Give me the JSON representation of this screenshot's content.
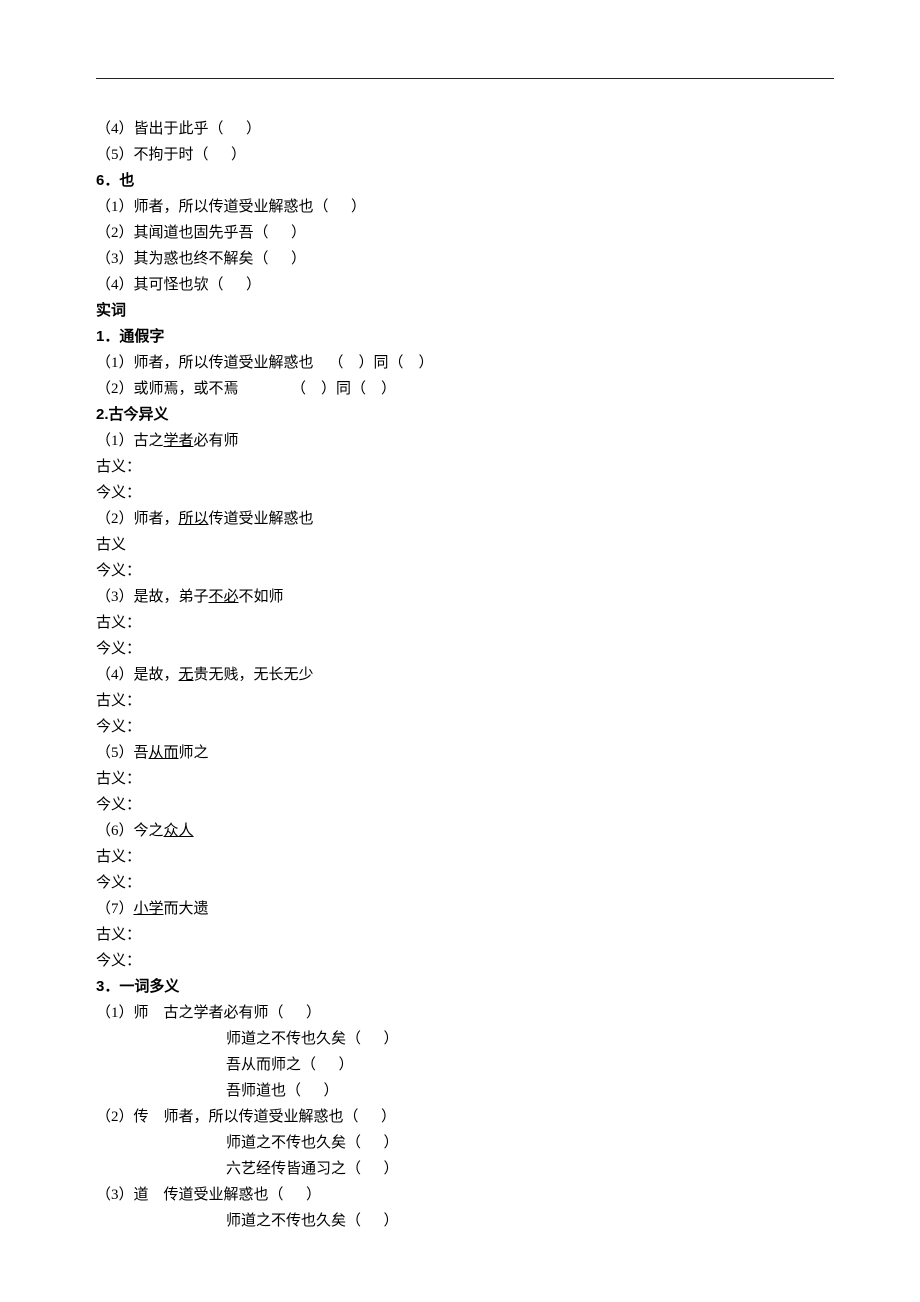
{
  "topLines": [
    "（4）皆出于此乎（      ）",
    "（5）不拘于时（      ）"
  ],
  "sec6": {
    "title": "6．也",
    "items": [
      "（1）师者，所以传道受业解惑也（      ）",
      "（2）其闻道也固先乎吾（      ）",
      "（3）其为惑也终不解矣（      ）",
      "（4）其可怪也欤（      ）"
    ]
  },
  "shici": "实词",
  "tongjia": {
    "title": "1．通假字",
    "items": [
      "（1）师者，所以传道受业解惑也    （    ）同（    ）",
      "（2）或师焉，或不焉              （    ）同（    ）"
    ]
  },
  "gujin": {
    "title": "2.古今异义",
    "items": [
      {
        "num": "（1）古之",
        "u": "学者",
        "rest": "必有师",
        "gu": "古义：",
        "jin": "今义："
      },
      {
        "num": "（2）师者，",
        "u": "所以",
        "rest": "传道受业解惑也",
        "gu": "古义",
        "jin": "今义："
      },
      {
        "num": "（3）是故，弟子",
        "u": "不必",
        "rest": "不如师",
        "gu": "古义：",
        "jin": "今义："
      },
      {
        "num": "（4）是故，",
        "u": "无",
        "rest": "贵无贱，无长无少",
        "gu": "古义：",
        "jin": "今义："
      },
      {
        "num": "（5）吾",
        "u": "从而",
        "rest": "师之",
        "gu": "古义：",
        "jin": "今义："
      },
      {
        "num": "（6）今之",
        "u": "众人",
        "rest": "",
        "gu": "古义：",
        "jin": "今义："
      },
      {
        "num": "（7）",
        "u": "小学",
        "rest": "而大遗",
        "gu": "古义：",
        "jin": "今义："
      }
    ]
  },
  "duoyi": {
    "title": "3．一词多义",
    "items": [
      {
        "head": "（1）师",
        "ex": [
          "古之学者必有师（      ）",
          "师道之不传也久矣（      ）",
          "吾从而师之（      ）",
          "吾师道也（      ）"
        ]
      },
      {
        "head": "（2）传",
        "ex": [
          "师者，所以传道受业解惑也（      ）",
          "师道之不传也久矣（      ）",
          "六艺经传皆通习之（      ）"
        ]
      },
      {
        "head": "（3）道",
        "ex": [
          "传道受业解惑也（      ）",
          "师道之不传也久矣（      ）"
        ]
      }
    ]
  }
}
